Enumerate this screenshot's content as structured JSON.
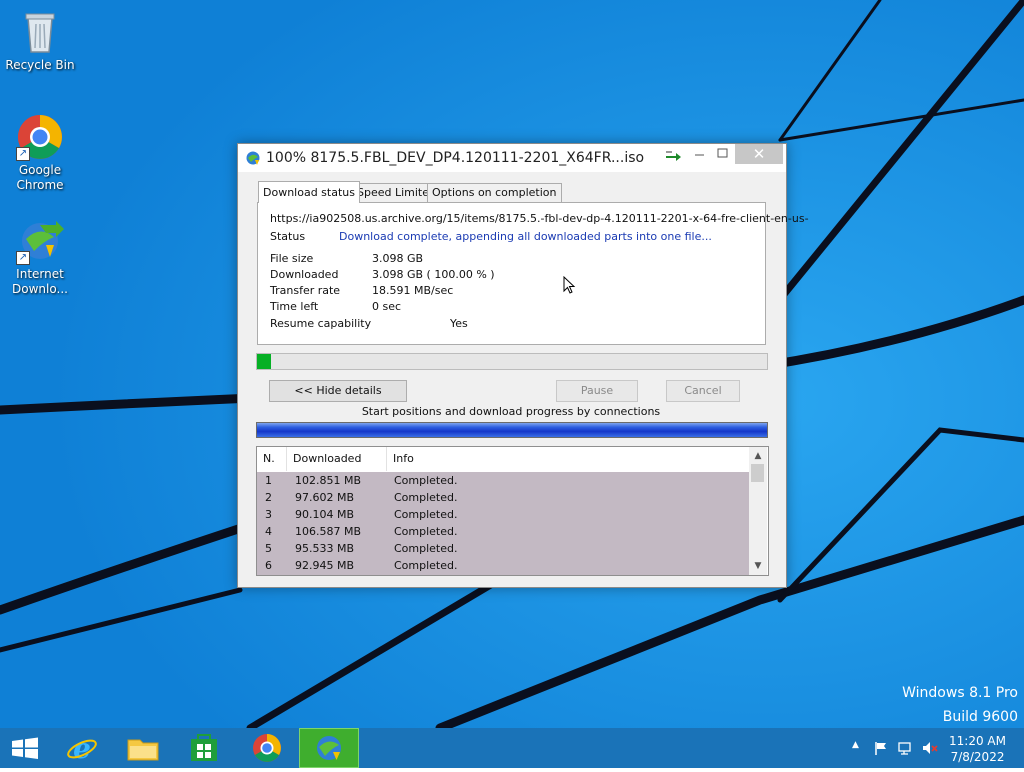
{
  "desktop": {
    "icons": [
      {
        "label": "Recycle Bin",
        "icon": "recycle-bin-icon"
      },
      {
        "label": "Google Chrome",
        "icon": "chrome-icon"
      },
      {
        "label": "Internet Downlo...",
        "icon": "idm-icon"
      }
    ],
    "watermark": {
      "line1": "Windows 8.1 Pro",
      "line2": "Build 9600"
    }
  },
  "window": {
    "title": "100% 8175.5.FBL_DEV_DP4.120111-2201_X64FR...iso",
    "tabs": [
      "Download status",
      "Speed Limiter",
      "Options on completion"
    ],
    "url": "https://ia902508.us.archive.org/15/items/8175.5.-fbl-dev-dp-4.120111-2201-x-64-fre-client-en-us-",
    "status_label": "Status",
    "status_value": "Download complete, appending all downloaded parts into one file...",
    "details": [
      {
        "label": "File size",
        "value": "3.098  GB"
      },
      {
        "label": "Downloaded",
        "value": "3.098  GB  ( 100.00 % )"
      },
      {
        "label": "Transfer rate",
        "value": "18.591  MB/sec"
      },
      {
        "label": "Time left",
        "value": "0 sec"
      }
    ],
    "resume_label": "Resume capability",
    "resume_value": "Yes",
    "progress_fraction": 0.027,
    "buttons": {
      "hide_details": "<< Hide details",
      "pause": "Pause",
      "cancel": "Cancel"
    },
    "connections_label": "Start positions and download progress by connections",
    "table": {
      "headers": [
        "N.",
        "Downloaded",
        "Info"
      ],
      "rows": [
        [
          "1",
          "102.851  MB",
          "Completed."
        ],
        [
          "2",
          "97.602  MB",
          "Completed."
        ],
        [
          "3",
          "90.104  MB",
          "Completed."
        ],
        [
          "4",
          "106.587  MB",
          "Completed."
        ],
        [
          "5",
          "95.533  MB",
          "Completed."
        ],
        [
          "6",
          "92.945  MB",
          "Completed."
        ]
      ]
    }
  },
  "taskbar": {
    "apps": [
      "start-icon",
      "internet-explorer-icon",
      "file-explorer-icon",
      "store-icon",
      "chrome-icon",
      "idm-icon"
    ],
    "clock_time": "11:20 AM",
    "clock_date": "7/8/2022"
  },
  "colors": {
    "desktop": "#1591e0",
    "progress": "#06b025",
    "status_text": "#1b3bb3",
    "taskbar": "#1a73b8"
  }
}
